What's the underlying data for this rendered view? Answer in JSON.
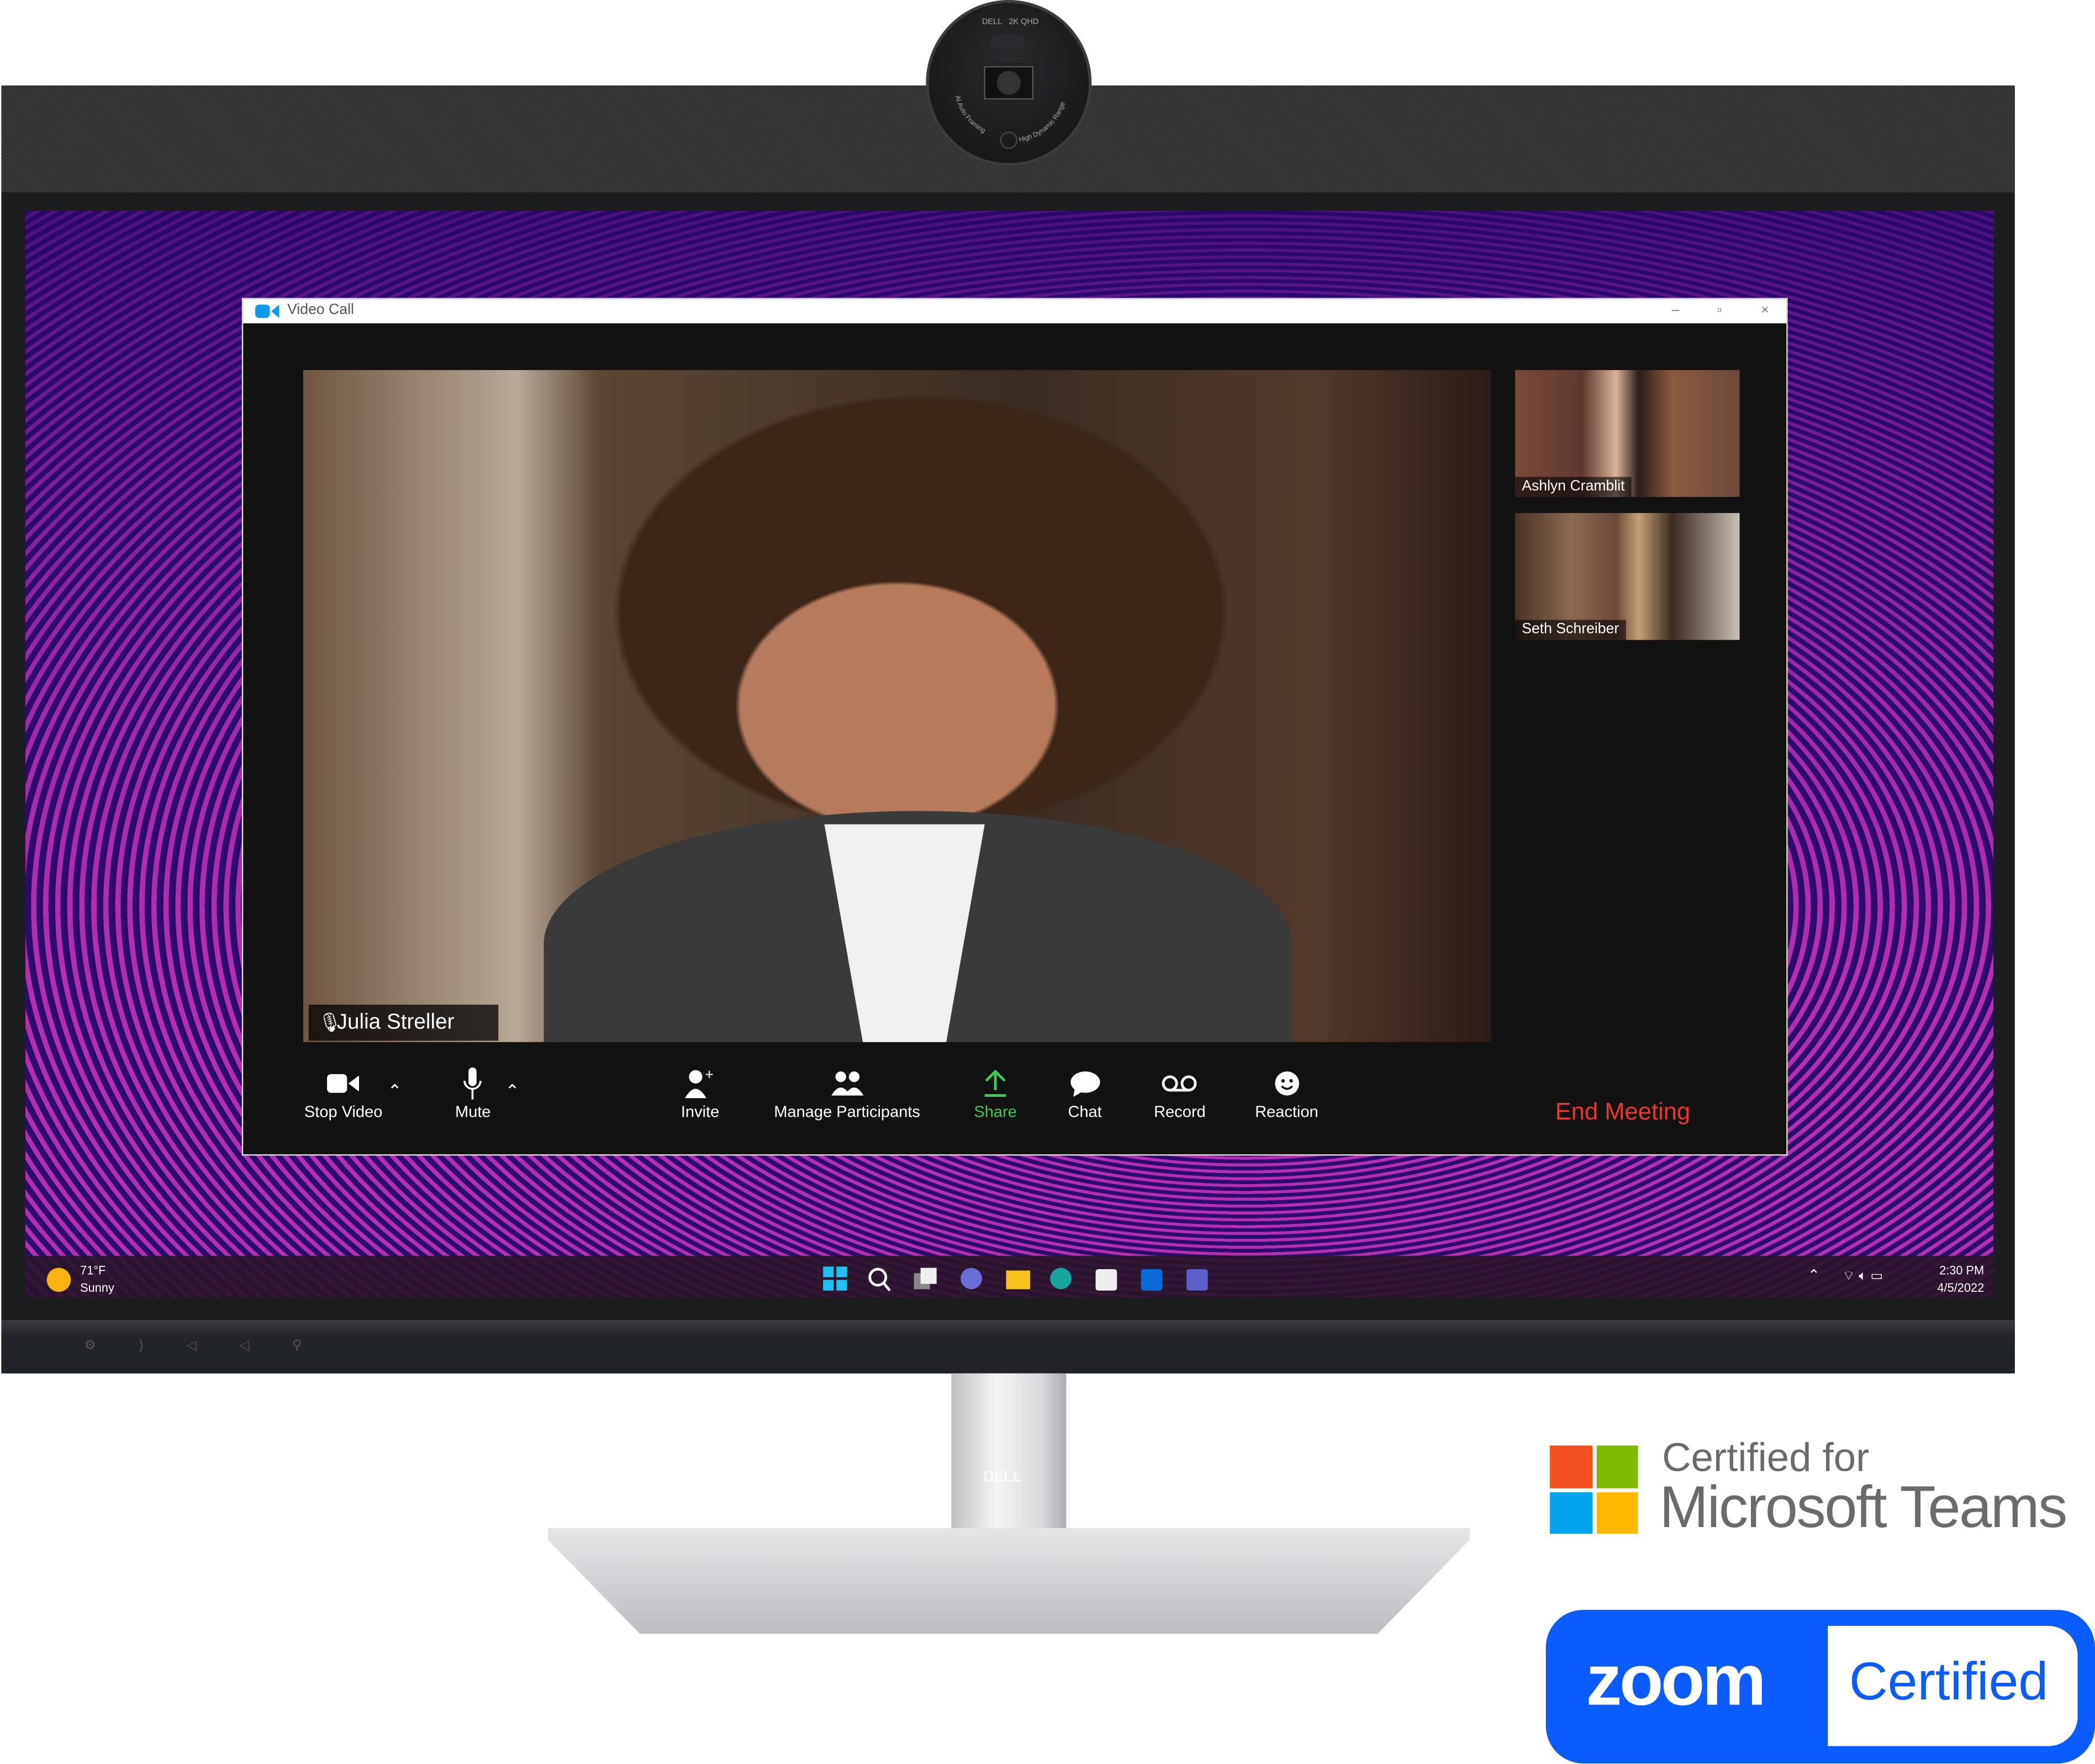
{
  "camera": {
    "brand": "DELL",
    "resolution": "2K QHD",
    "feature_left": "AI Auto Framing",
    "feature_right": "High Dynamic Range"
  },
  "window": {
    "title": "Video Call",
    "icon": "video-camera-icon",
    "controls": [
      "minimize",
      "maximize",
      "close"
    ]
  },
  "main_video": {
    "participant": "Julia Streller",
    "mic_icon": "microphone-icon"
  },
  "thumbnails": [
    {
      "name": "Ashlyn Cramblit"
    },
    {
      "name": "Seth Schreiber"
    }
  ],
  "toolbar": {
    "items": [
      {
        "label": "Stop Video",
        "icon": "video-camera-icon",
        "has_menu": true
      },
      {
        "label": "Mute",
        "icon": "microphone-icon",
        "has_menu": true
      },
      {
        "label": "Invite",
        "icon": "add-person-icon"
      },
      {
        "label": "Manage Participants",
        "icon": "participants-icon"
      },
      {
        "label": "Share",
        "icon": "share-up-arrow-icon",
        "color": "#3fc95a"
      },
      {
        "label": "Chat",
        "icon": "chat-bubble-icon"
      },
      {
        "label": "Record",
        "icon": "record-icon"
      },
      {
        "label": "Reaction",
        "icon": "smiley-icon"
      }
    ],
    "end_meeting": "End Meeting",
    "end_color": "#e8382f"
  },
  "taskbar": {
    "weather_temp": "71°F",
    "weather_desc": "Sunny",
    "apps": [
      "start",
      "search",
      "task-view",
      "chat",
      "file-explorer",
      "edge",
      "store",
      "outlook",
      "teams"
    ],
    "time": "2:30 PM",
    "date": "4/5/2022"
  },
  "stand_logo": "DELL",
  "badges": {
    "teams_line1": "Certified for",
    "teams_line2": "Microsoft Teams",
    "teams_colors": [
      "#f25022",
      "#7fba00",
      "#00a4ef",
      "#ffb900"
    ],
    "zoom_logo": "zoom",
    "zoom_certified": "Certified",
    "zoom_color": "#0b5cff"
  }
}
